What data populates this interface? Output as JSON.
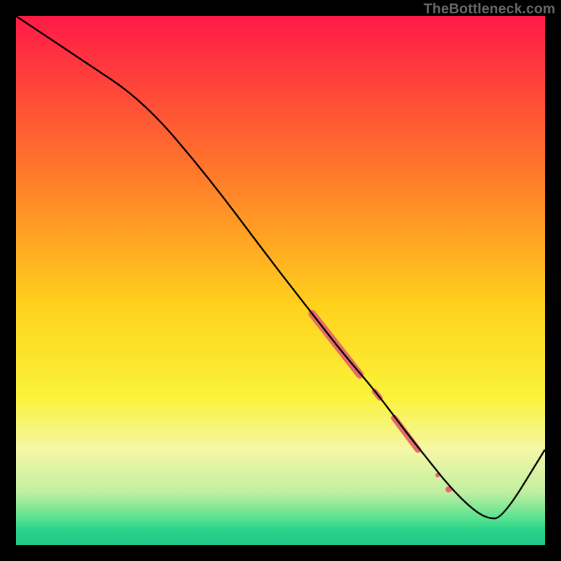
{
  "watermark": "TheBottleneck.com",
  "colors": {
    "frame": "#000000",
    "line": "#000000",
    "marker": "#e76a6a"
  },
  "chart_data": {
    "type": "line",
    "title": "",
    "xlabel": "",
    "ylabel": "",
    "xlim": [
      0,
      100
    ],
    "ylim": [
      0,
      100
    ],
    "gradient_stops": [
      {
        "offset": 0.0,
        "color": "#ff1a47"
      },
      {
        "offset": 0.3,
        "color": "#ff7a2a"
      },
      {
        "offset": 0.55,
        "color": "#ffd21c"
      },
      {
        "offset": 0.72,
        "color": "#faf33a"
      },
      {
        "offset": 0.82,
        "color": "#f5f7a6"
      },
      {
        "offset": 0.9,
        "color": "#c1f0a1"
      },
      {
        "offset": 0.955,
        "color": "#4de08f"
      },
      {
        "offset": 0.97,
        "color": "#2bd48a"
      },
      {
        "offset": 1.0,
        "color": "#20c985"
      }
    ],
    "series": [
      {
        "name": "bottleneck-curve",
        "x": [
          0,
          12,
          24,
          36,
          48,
          55,
          62,
          68,
          74,
          78,
          82,
          86,
          89,
          92,
          100
        ],
        "y": [
          100,
          92,
          84,
          70,
          54,
          45,
          36,
          29,
          21,
          16,
          11,
          7,
          5,
          5,
          18
        ]
      }
    ],
    "highlight_segments": [
      {
        "x1": 56.0,
        "y1": 43.7,
        "x2": 65.0,
        "y2": 32.2,
        "width": 11
      },
      {
        "x1": 67.8,
        "y1": 29.0,
        "x2": 68.8,
        "y2": 27.8,
        "width": 8
      },
      {
        "x1": 71.5,
        "y1": 24.0,
        "x2": 76.0,
        "y2": 18.0,
        "width": 9
      }
    ],
    "highlight_dots": [
      {
        "x": 79.7,
        "y": 13.2,
        "r": 3.2
      },
      {
        "x": 81.8,
        "y": 10.5,
        "r": 4.5
      }
    ]
  }
}
